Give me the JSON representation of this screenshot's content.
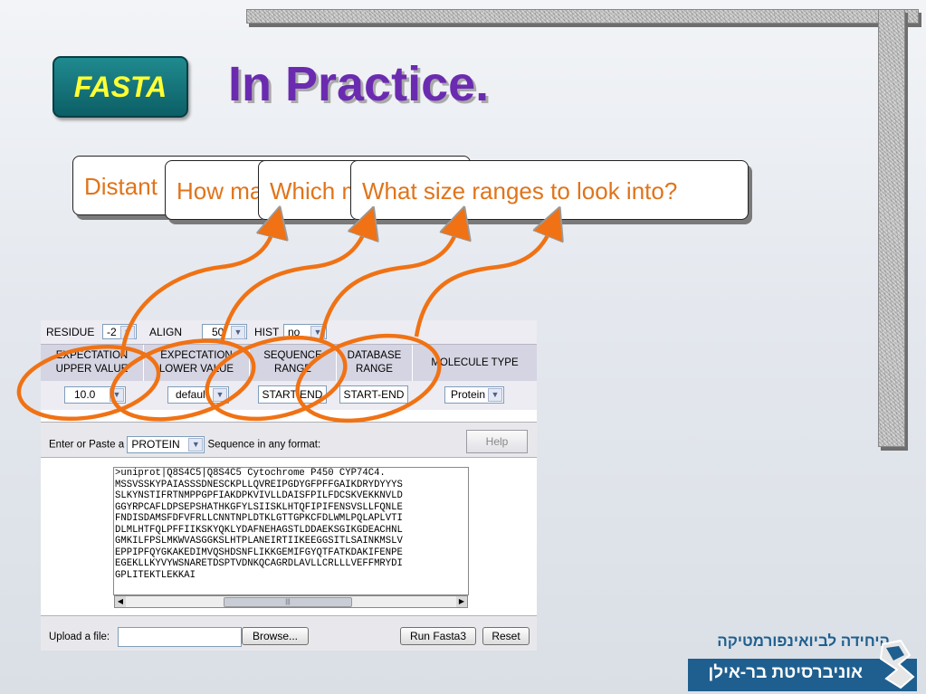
{
  "slide": {
    "badge": "FASTA",
    "title": "In Practice.",
    "callouts": [
      "Distant homologs?",
      "How many results?",
      "Which matches count?",
      "What size ranges to look into?"
    ]
  },
  "form": {
    "options": {
      "residue_label": "RESIDUE",
      "residue_value": "-2",
      "align_label": "ALIGN",
      "align_value": "50",
      "hist_label": "HIST",
      "hist_value": "no"
    },
    "columns": [
      {
        "header": "EXPECTATION UPPER VALUE",
        "value": "10.0"
      },
      {
        "header": "EXPECTATION LOWER VALUE",
        "value": "default"
      },
      {
        "header": "SEQUENCE RANGE",
        "value": "START-END"
      },
      {
        "header": "DATABASE RANGE",
        "value": "START-END"
      },
      {
        "header": "MOLECULE TYPE",
        "value": "Protein"
      }
    ],
    "paste_prefix": "Enter or Paste a",
    "paste_type": "PROTEIN",
    "paste_suffix": "Sequence in any format:",
    "help_label": "Help",
    "sequence_lines": [
      ">uniprot|Q8S4C5|Q8S4C5 Cytochrome P450 CYP74C4.",
      "MSSVSSKYPAIASSSDNESCKPLLQVREIPGDYGFPFFGAIKDRYDYYYS",
      "SLKYNSTIFRTNMPPGPFIAKDPKVIVLLDAISFPILFDCSKVEKKNVLD",
      "GGYRPCAFLDPSEPSHATHKGFYLSIISKLHTQFIPIFENSVSLLFQNLE",
      "FNDISDAMSFDFVFRLLCNNTNPLDTKLGTTGPKCFDLWMLPQLAPLVTI",
      "DLMLHTFQLPFFIIKSKYQKLYDAFNEHAGSTLDDAEKSGIKGDEACHNL",
      "GMKILFPSLMKWVASGGKSLHTPLANEIRTIIKEEGGSITLSAINKMSLV",
      "EPPIPFQYGKAKEDIMVQSHDSNFLIKKGEMIFGYQTFATKDAKIFENPE",
      "EGEKLLKYVYWSNARETDSPTVDNKQCAGRDLAVLLCRLLLVEFFMRYDI",
      "GPLITEKTLEKKAI"
    ],
    "upload_label": "Upload a file:",
    "browse_label": "Browse...",
    "run_label": "Run Fasta3",
    "reset_label": "Reset"
  },
  "logo": {
    "top_text": "היחידה לביואינפורמטיקה",
    "bottom_text": "אוניברסיטת בר-אילן"
  },
  "colors": {
    "title": "#6b2bb0",
    "callout_text": "#e0741a",
    "ellipse": "#f07214",
    "badge_bg": "#0c5f66",
    "badge_text": "#ffff33",
    "logo": "#1f5f8f"
  }
}
